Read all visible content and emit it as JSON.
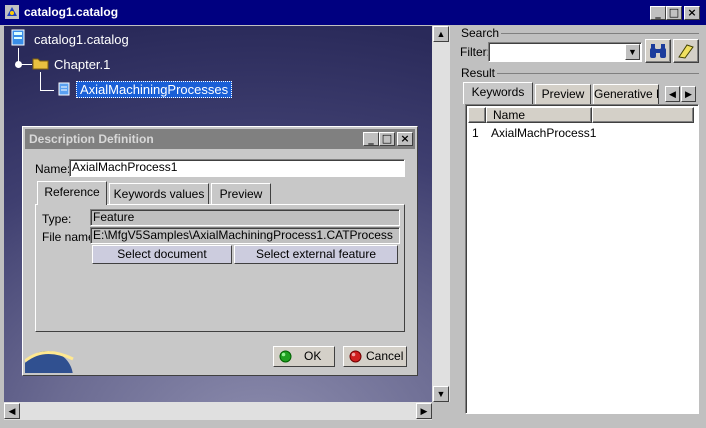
{
  "window": {
    "title": "catalog1.catalog",
    "minimize": "_",
    "maximize": "□",
    "close": "×"
  },
  "tree": {
    "root": "catalog1.catalog",
    "chapter": "Chapter.1",
    "item": "AxialMachiningProcesses"
  },
  "dialog": {
    "title": "Description Definition",
    "name_label": "Name:",
    "name_value": "AxialMachProcess1",
    "tabs": [
      "Reference",
      "Keywords values",
      "Preview"
    ],
    "type_label": "Type:",
    "type_value": "Feature",
    "file_label": "File name:",
    "file_value": "E:\\MfgV5Samples\\AxialMachiningProcess1.CATProcess",
    "select_document": "Select document",
    "select_external": "Select external feature",
    "ok": "OK",
    "cancel": "Cancel"
  },
  "search": {
    "section": "Search",
    "filter_label": "Filter:",
    "filter_value": "",
    "result_label": "Result",
    "tabs": [
      "Keywords",
      "Preview",
      "Generative D"
    ],
    "columns": [
      "Name"
    ],
    "rows": [
      {
        "index": "1",
        "name": "AxialMachProcess1"
      }
    ]
  },
  "colors": {
    "titlebar": "#000080",
    "selection": "#1a5fd6",
    "viewer_bg": "#3f3f70"
  }
}
